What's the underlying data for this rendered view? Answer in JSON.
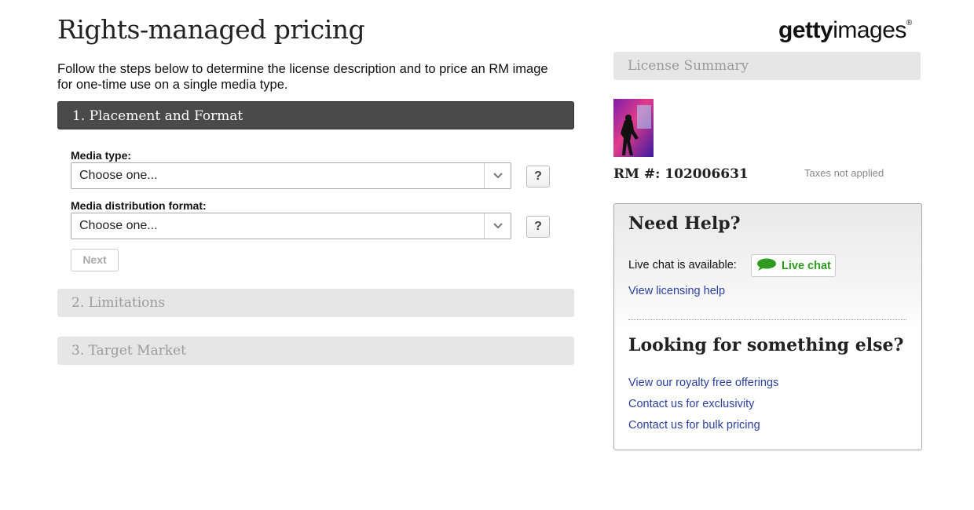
{
  "header": {
    "title": "Rights-managed pricing",
    "logo_bold": "getty",
    "logo_light": "images",
    "logo_mark": "®"
  },
  "intro": {
    "line1": "Follow the steps below to determine the license description and to price an RM image",
    "line2": "for one-time use on a single media type."
  },
  "steps": [
    {
      "label": "1. Placement and Format",
      "state": "active"
    },
    {
      "label": "2. Limitations",
      "state": "inactive"
    },
    {
      "label": "3. Target Market",
      "state": "inactive"
    }
  ],
  "form": {
    "media_type": {
      "label": "Media type:",
      "value": "Choose one..."
    },
    "distribution_format": {
      "label": "Media distribution format:",
      "value": "Choose one..."
    },
    "help_glyph": "?",
    "next_label": "Next"
  },
  "summary": {
    "title": "License Summary",
    "rm_number": "RM #: 102006631",
    "tax_note": "Taxes not applied"
  },
  "help": {
    "title": "Need Help?",
    "live_chat_label": "Live chat is available:",
    "live_chat_button": "Live chat",
    "licensing_link": "View licensing help",
    "else_title": "Looking for something else?",
    "links": [
      "View our royalty free offerings",
      "Contact us for exclusivity",
      "Contact us for bulk pricing"
    ]
  },
  "colors": {
    "active_step_bg": "#4a4a4a",
    "inactive_step_bg": "#e6e6e6",
    "link": "#2a3fa0",
    "live_chat_green": "#2e9a1f"
  },
  "icons": {
    "select_arrow": "chevron-down-icon",
    "chat": "speech-bubble-icon"
  }
}
